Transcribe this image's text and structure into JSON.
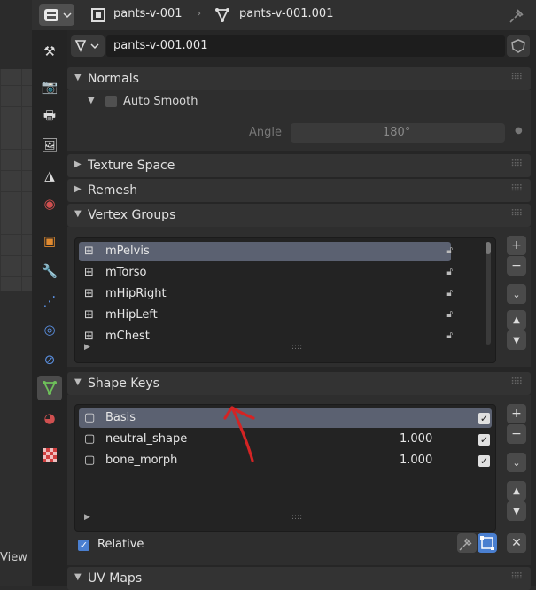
{
  "header": {
    "object_name": "pants-v-001",
    "mesh_name": "pants-v-001.001"
  },
  "datablock": {
    "name": "pants-v-001.001"
  },
  "normals": {
    "title": "Normals",
    "auto_smooth_label": "Auto Smooth",
    "auto_smooth_checked": false,
    "angle_label": "Angle",
    "angle_value": "180°"
  },
  "texture_space": {
    "title": "Texture Space"
  },
  "remesh": {
    "title": "Remesh"
  },
  "vertex_groups": {
    "title": "Vertex Groups",
    "items": [
      {
        "name": "mPelvis",
        "selected": true
      },
      {
        "name": "mTorso",
        "selected": false
      },
      {
        "name": "mHipRight",
        "selected": false
      },
      {
        "name": "mHipLeft",
        "selected": false
      },
      {
        "name": "mChest",
        "selected": false
      }
    ]
  },
  "shape_keys": {
    "title": "Shape Keys",
    "items": [
      {
        "name": "Basis",
        "value": "",
        "checked": true,
        "selected": true
      },
      {
        "name": "neutral_shape",
        "value": "1.000",
        "checked": true,
        "selected": false
      },
      {
        "name": "bone_morph",
        "value": "1.000",
        "checked": true,
        "selected": false
      }
    ],
    "relative_label": "Relative",
    "relative_checked": true
  },
  "uv_maps": {
    "title": "UV Maps"
  },
  "viewport": {
    "label": "View"
  },
  "colors": {
    "selection": "#5b6171",
    "checkbox_blue": "#4a7fd0",
    "annotation_red": "#d42424",
    "tab_green": "#6ec05a"
  }
}
